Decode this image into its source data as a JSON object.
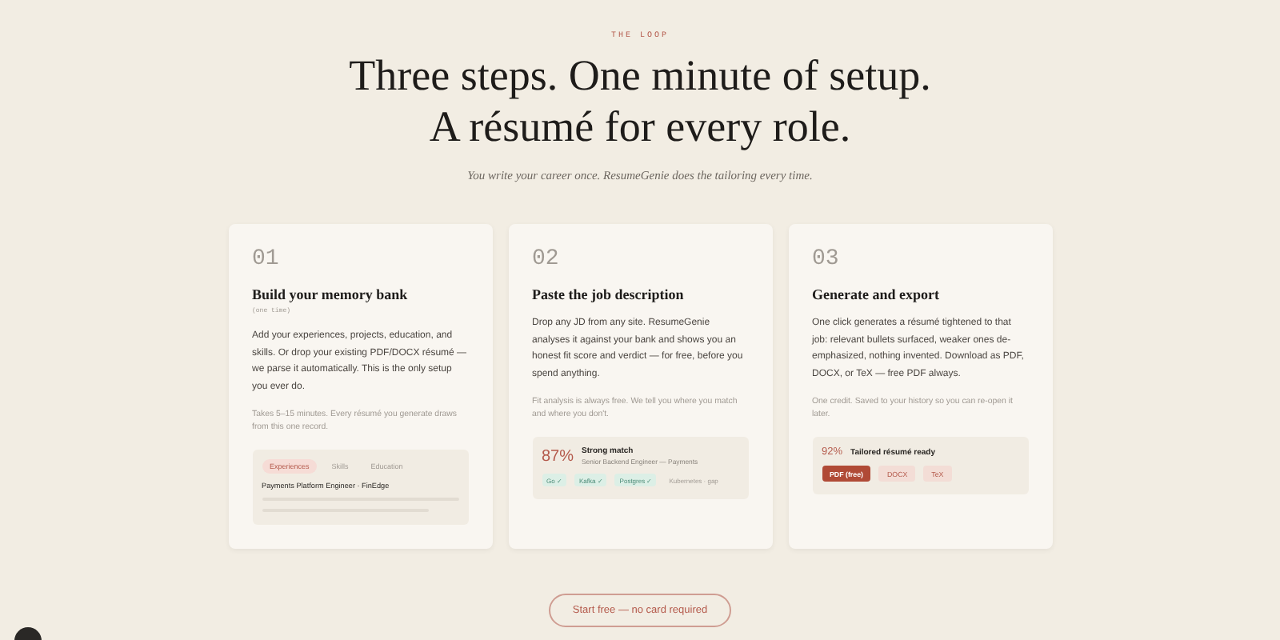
{
  "kicker": "THE LOOP",
  "headline": [
    "Three steps. One minute of setup.",
    "A résumé for every role."
  ],
  "subtitle": "You write your career once. ResumeGenie does the tailoring every time.",
  "steps": [
    {
      "kind": "bank",
      "number": "01",
      "title": "Build your memory bank",
      "tag": "(one time)",
      "body": "Add your experiences, projects, education, and skills. Or drop your existing PDF/DOCX résumé — we parse it automatically. This is the only setup you ever do.",
      "note": "Takes 5–15 minutes. Every résumé you generate draws from this one record.",
      "preview": {
        "tabs": [
          {
            "label": "Experiences",
            "selected": true
          },
          {
            "label": "Skills",
            "selected": false
          },
          {
            "label": "Education",
            "selected": false
          }
        ],
        "entry": "Payments Platform Engineer · FinEdge"
      }
    },
    {
      "kind": "match",
      "number": "02",
      "title": "Paste the job description",
      "body": "Drop any JD from any site. ResumeGenie analyses it against your bank and shows you an honest fit score and verdict — for free, before you spend anything.",
      "note": "Fit analysis is always free. We tell you where you match and where you don't.",
      "preview": {
        "score": "87%",
        "verdict": "Strong match",
        "role": "Senior Backend Engineer — Payments",
        "skills": [
          {
            "label": "Go ✓",
            "kind": "match"
          },
          {
            "label": "Kafka ✓",
            "kind": "match"
          },
          {
            "label": "Postgres ✓",
            "kind": "match"
          },
          {
            "label": "Kubernetes · gap",
            "kind": "gap"
          }
        ]
      }
    },
    {
      "kind": "export",
      "number": "03",
      "title": "Generate and export",
      "body": "One click generates a résumé tightened to that job: relevant bullets surfaced, weaker ones de-emphasized, nothing invented. Download as PDF, DOCX, or TeX — free PDF always.",
      "note": "One credit. Saved to your history so you can re-open it later.",
      "preview": {
        "score": "92%",
        "status": "Tailored résumé ready",
        "formats": [
          {
            "label": "PDF (free)",
            "selected": true
          },
          {
            "label": "DOCX",
            "selected": false
          },
          {
            "label": "TeX",
            "selected": false
          }
        ]
      }
    }
  ],
  "cta": "Start free — no card required"
}
